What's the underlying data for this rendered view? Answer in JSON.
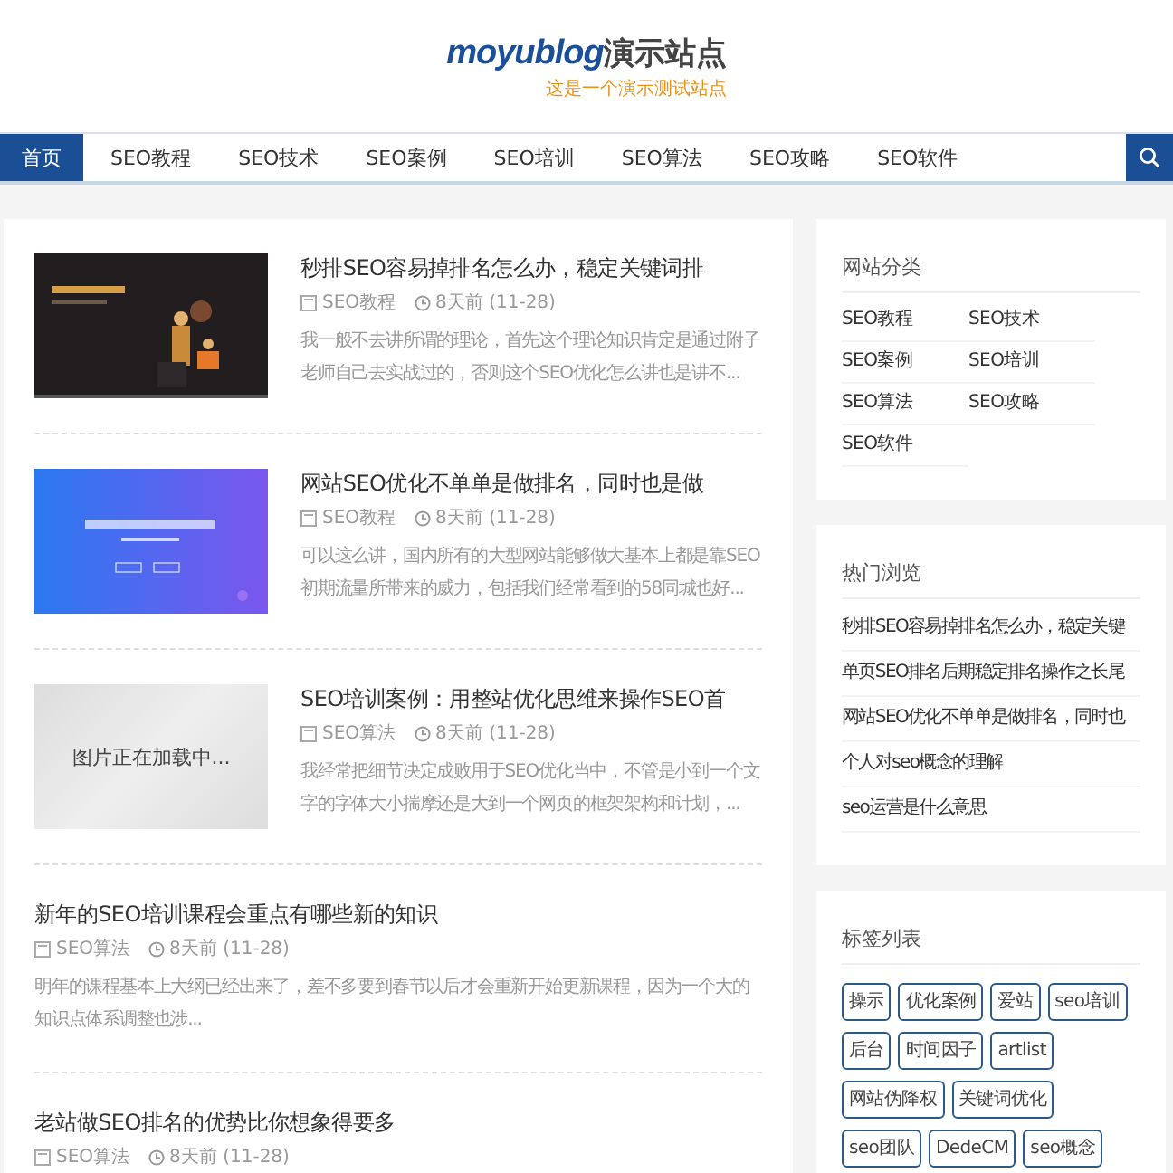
{
  "logo": {
    "brand": "moyublog",
    "name": "演示站点",
    "tagline": "这是一个演示测试站点"
  },
  "nav": {
    "items": [
      {
        "label": "首页",
        "selected": true
      },
      {
        "label": "SEO教程",
        "selected": false
      },
      {
        "label": "SEO技术",
        "selected": false
      },
      {
        "label": "SEO案例",
        "selected": false
      },
      {
        "label": "SEO培训",
        "selected": false
      },
      {
        "label": "SEO算法",
        "selected": false
      },
      {
        "label": "SEO攻略",
        "selected": false
      },
      {
        "label": "SEO软件",
        "selected": false
      }
    ]
  },
  "articles": [
    {
      "title": "秒排SEO容易掉排名怎么办，稳定关键词排",
      "category": "SEO教程",
      "date": "8天前 (11-28)",
      "excerpt": "我一般不去讲所谓的理论，首先这个理论知识肯定是通过附子老师自己去实战过的，否则这个SEO优化怎么讲也是讲不..."
    },
    {
      "title": "网站SEO优化不单单是做排名，同时也是做",
      "category": "SEO教程",
      "date": "8天前 (11-28)",
      "excerpt": "可以这么讲，国内所有的大型网站能够做大基本上都是靠SEO初期流量所带来的威力，包括我们经常看到的58同城也好..."
    },
    {
      "thumbnail": {
        "kind": "loading",
        "text": "图片正在加载中..."
      },
      "title": "SEO培训案例：用整站优化思维来操作SEO首",
      "category": "SEO算法",
      "date": "8天前 (11-28)",
      "excerpt": "我经常把细节决定成败用于SEO优化当中，不管是小到一个文字的字体大小揣摩还是大到一个网页的框架架构和计划，..."
    },
    {
      "title": "新年的SEO培训课程会重点有哪些新的知识",
      "category": "SEO算法",
      "date": "8天前 (11-28)",
      "excerpt": "明年的课程基本上大纲已经出来了，差不多要到春节以后才会重新开始更新课程，因为一个大的知识点体系调整也涉..."
    },
    {
      "title": "老站做SEO排名的优势比你想象得要多",
      "category": "SEO算法",
      "date": "8天前 (11-28)"
    }
  ],
  "sidebar": [
    {
      "kind": "categories",
      "title": "网站分类",
      "items": [
        "SEO教程",
        "SEO技术",
        "SEO案例",
        "SEO培训",
        "SEO算法",
        "SEO攻略",
        "SEO软件"
      ]
    },
    {
      "kind": "list",
      "title": "热门浏览",
      "items": [
        "秒排SEO容易掉排名怎么办，稳定关键",
        "单页SEO排名后期稳定排名操作之长尾",
        "网站SEO优化不单单是做排名，同时也",
        "个人对seo概念的理解",
        "seo运营是什么意思"
      ]
    },
    {
      "kind": "tags",
      "title": "标签列表",
      "items": [
        "操示",
        "优化案例",
        "爱站",
        "seo培训",
        "后台",
        "时间因子",
        "artlist",
        "网站伪降权",
        "关键词优化",
        "seo团队",
        "DedeCM",
        "seo概念"
      ]
    }
  ]
}
